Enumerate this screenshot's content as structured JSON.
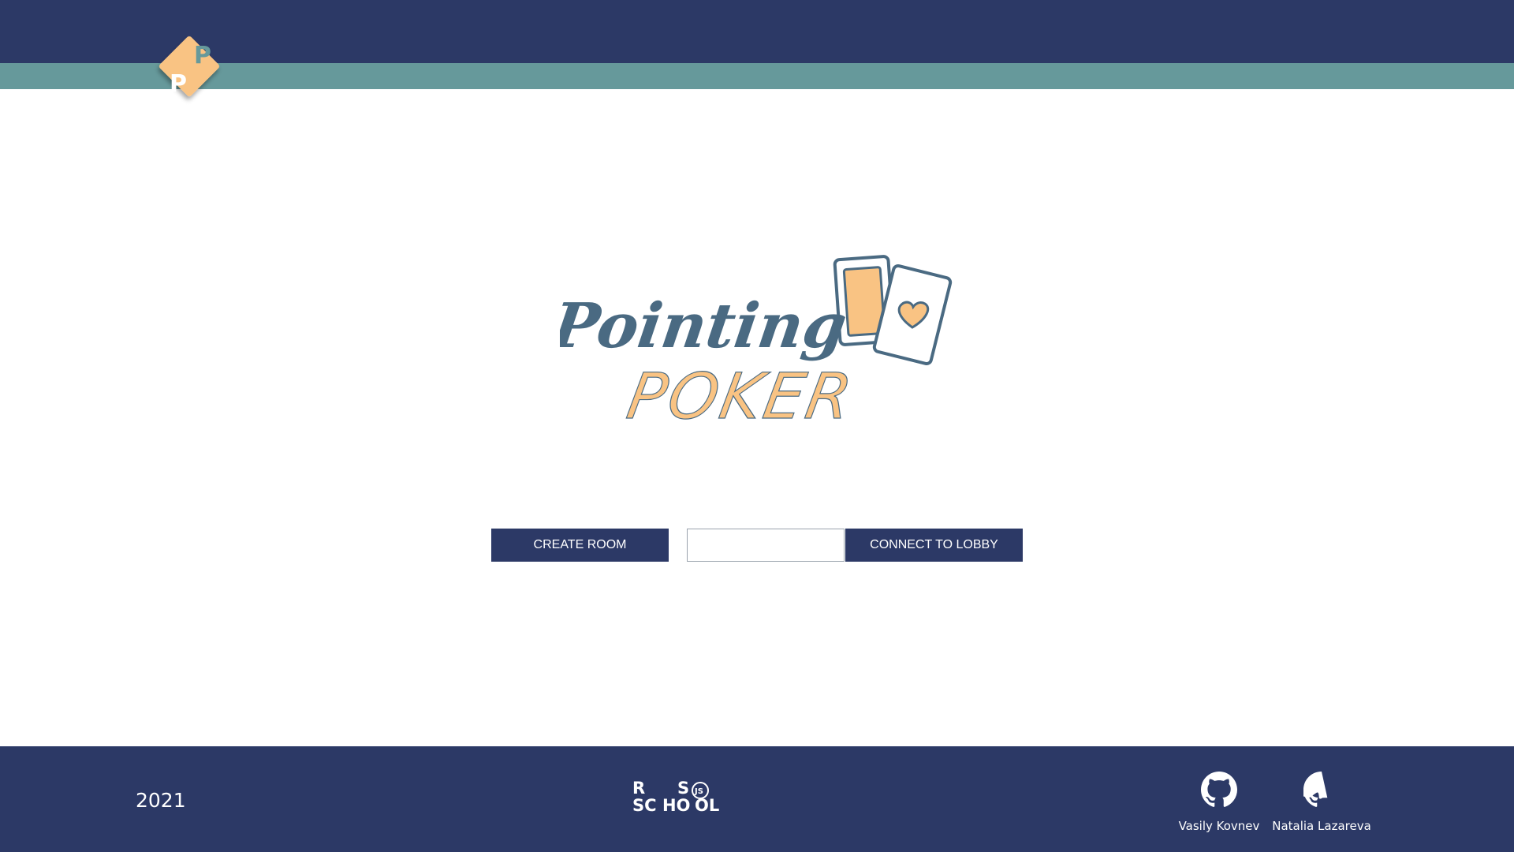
{
  "colors": {
    "navy": "#2c3966",
    "teal": "#66999b",
    "orange": "#f9c383",
    "slate": "#4a6a82",
    "white": "#ffffff"
  },
  "header": {
    "logo_letters": [
      "P",
      "P"
    ]
  },
  "main": {
    "logo_word_1": "Pointing",
    "logo_word_2": "POKER",
    "create_button_label": "CREATE ROOM",
    "lobby_input_value": "",
    "connect_button_label": "CONNECT TO LOBBY"
  },
  "footer": {
    "year": "2021",
    "rs_logo_text": [
      "R",
      "S",
      "SC",
      "HO",
      "JS",
      "OL"
    ],
    "authors": [
      {
        "name": "Vasily Kovnev",
        "icon": "github-icon"
      },
      {
        "name": "Natalia Lazareva",
        "icon": "github-icon"
      }
    ]
  }
}
